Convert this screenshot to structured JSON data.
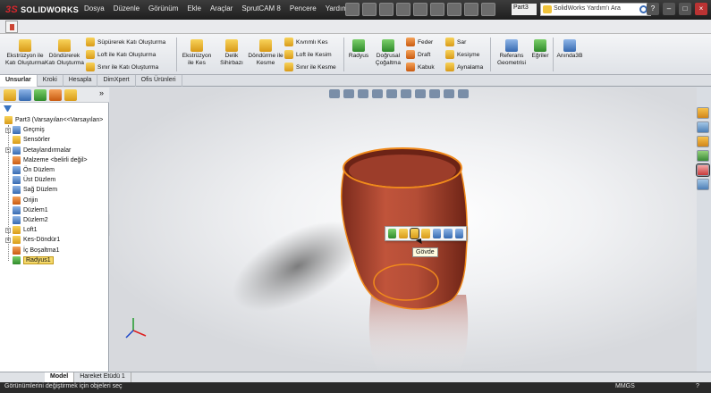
{
  "titlebar": {
    "app_name": "SOLIDWORKS",
    "menu": [
      "Dosya",
      "Düzenle",
      "Görünüm",
      "Ekle",
      "Araçlar",
      "SprutCAM 8",
      "Pencere",
      "Yardım"
    ],
    "document": "Part3",
    "help_search_placeholder": "SolidWorks Yardım'ı Ara"
  },
  "ribbon": {
    "extrude_boss": "Ekstrüzyon ile Katı Oluşturma",
    "revolve_boss": "Döndürerek Katı Oluşturma",
    "sweep_boss": "Süpürerek Katı Oluşturma",
    "loft_boss": "Loft ile Katı Oluşturma",
    "boundary_boss": "Sınır ile Katı Oluşturma",
    "extrude_cut": "Ekstrüzyon ile Kes",
    "hole_wizard": "Delik Sihirbazı",
    "revolve_cut": "Döndürme ile Kesme",
    "swept_cut": "Kıvrımlı Kes",
    "loft_cut": "Loft ile Kesim",
    "boundary_cut": "Sınır ile Kesme",
    "fillet": "Radyus",
    "linear_pattern": "Doğrusal Çoğaltma",
    "rib": "Feder",
    "draft": "Draft",
    "shell": "Kabuk",
    "wrap": "Sar",
    "intersect": "Kesişme",
    "mirror": "Aynalama",
    "ref_geometry": "Referans Geometrisi",
    "curves": "Eğriler",
    "instant3d": "Anında3B"
  },
  "tabs": [
    "Unsurlar",
    "Kroki",
    "Hesapla",
    "DimXpert",
    "Ofis Ürünleri"
  ],
  "tree": {
    "root": "Part3  (Varsayılan<<Varsayılan>",
    "items": [
      "Geçmiş",
      "Sensörler",
      "Detaylandırmalar",
      "Malzeme <belirli değil>",
      "Ön Düzlem",
      "Üst Düzlem",
      "Sağ Düzlem",
      "Orijin",
      "Düzlem1",
      "Düzlem2",
      "Loft1",
      "Kes-Döndür1",
      "İç Boşaltma1",
      "Radyus1"
    ]
  },
  "viewport": {
    "tooltip": "Gövde"
  },
  "bottom_tabs": [
    "Model",
    "Hareket Etüdü 1"
  ],
  "status": {
    "message": "Görünümlerini değiştirmek için objeleri seç",
    "units": "MMGS"
  },
  "colors": {
    "body": "#b44d36",
    "selection_edge": "#f08a1c",
    "status_bg": "#2a2a2a"
  }
}
